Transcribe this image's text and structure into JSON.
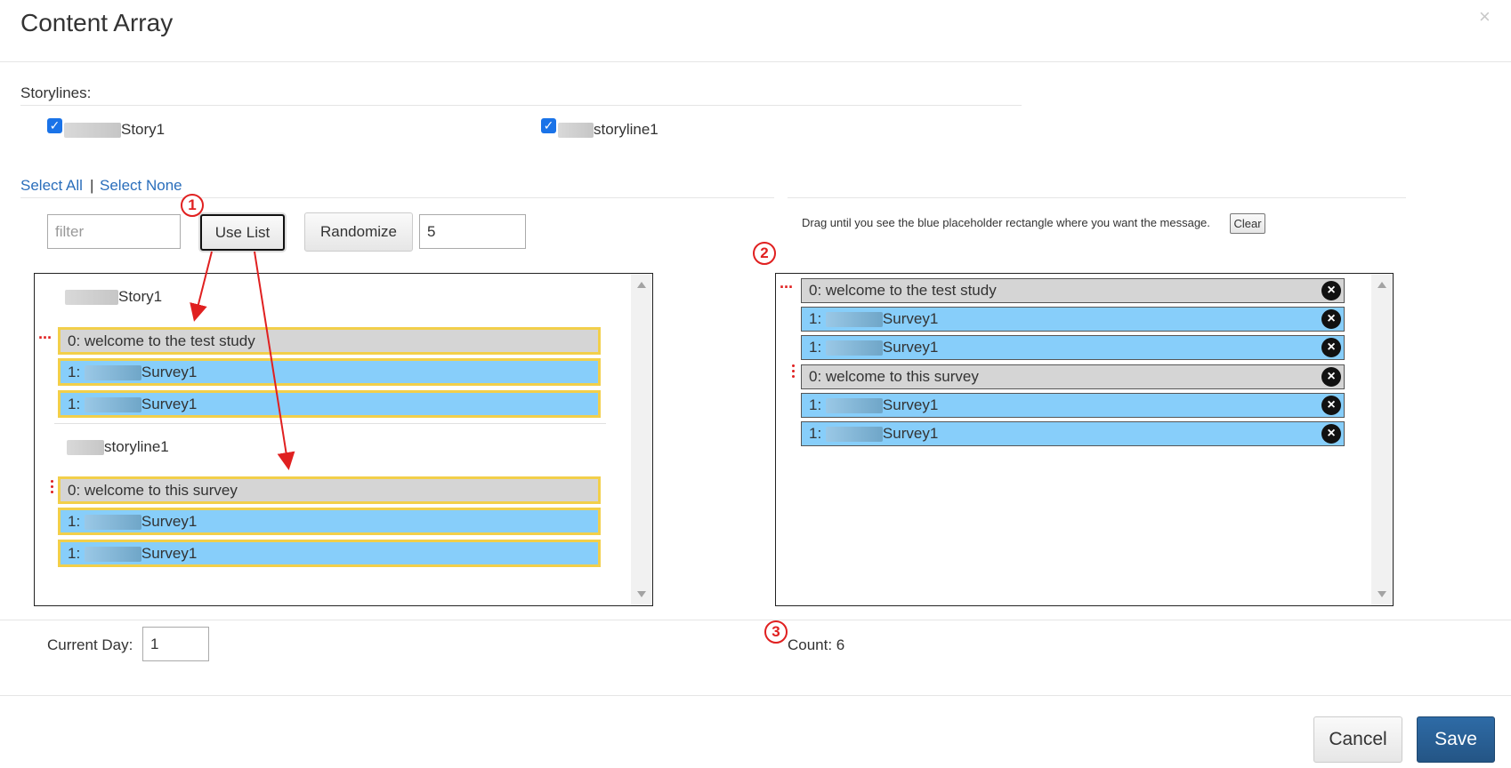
{
  "dialog": {
    "title": "Content Array",
    "close_icon": "×"
  },
  "storylines": {
    "label": "Storylines:",
    "items": [
      {
        "label": "Story1",
        "checked": true
      },
      {
        "label": "storyline1",
        "checked": true
      }
    ]
  },
  "selection": {
    "select_all": "Select All",
    "separator": "|",
    "select_none": "Select None"
  },
  "toolbar": {
    "filter_placeholder": "filter",
    "use_list_label": "Use List",
    "randomize_label": "Randomize",
    "randomize_count": "5"
  },
  "right_panel": {
    "hint": "Drag until you see the blue placeholder rectangle where you want the message.",
    "clear_label": "Clear"
  },
  "left_list": {
    "groups": [
      {
        "label": "Story1",
        "items": [
          {
            "prefix": "0: welcome to the test study",
            "suffix": "",
            "style": "gray"
          },
          {
            "prefix": "1:",
            "suffix": "Survey1",
            "style": "blue"
          },
          {
            "prefix": "1:",
            "suffix": "Survey1",
            "style": "blue"
          }
        ]
      },
      {
        "label": "storyline1",
        "items": [
          {
            "prefix": "0: welcome to this survey",
            "suffix": "",
            "style": "gray"
          },
          {
            "prefix": "1:",
            "suffix": "Survey1",
            "style": "blue"
          },
          {
            "prefix": "1:",
            "suffix": "Survey1",
            "style": "blue"
          }
        ]
      }
    ]
  },
  "right_list": {
    "items": [
      {
        "prefix": "0: welcome to the test study",
        "suffix": "",
        "style": "gray"
      },
      {
        "prefix": "1:",
        "suffix": "Survey1",
        "style": "blue"
      },
      {
        "prefix": "1:",
        "suffix": "Survey1",
        "style": "blue"
      },
      {
        "prefix": "0: welcome to this survey",
        "suffix": "",
        "style": "gray"
      },
      {
        "prefix": "1:",
        "suffix": "Survey1",
        "style": "blue"
      },
      {
        "prefix": "1:",
        "suffix": "Survey1",
        "style": "blue"
      }
    ],
    "remove_icon": "×"
  },
  "annotations": {
    "badges": [
      "1",
      "2",
      "3"
    ],
    "color": "#e02020"
  },
  "footer_info": {
    "current_day_label": "Current Day:",
    "current_day_value": "1",
    "count_text": "Count: 6"
  },
  "footer": {
    "cancel_label": "Cancel",
    "save_label": "Save"
  }
}
